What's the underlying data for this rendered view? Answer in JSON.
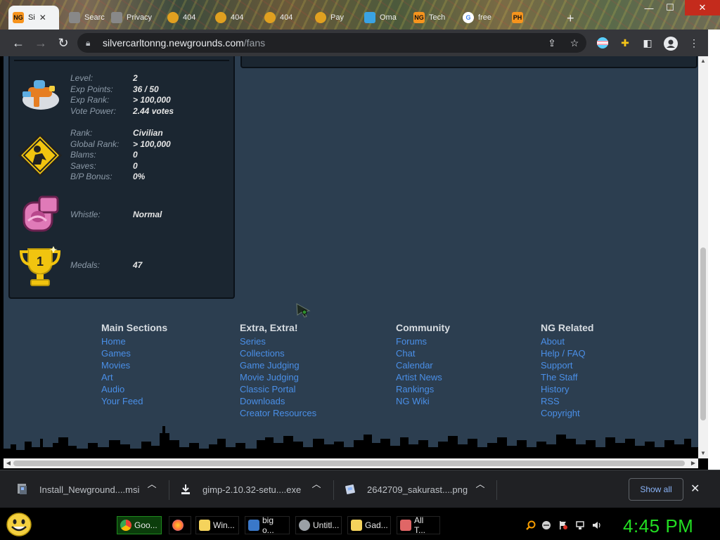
{
  "browser": {
    "tabs": [
      {
        "label": "Si",
        "favicon_color": "#f7941d",
        "favicon_text": "NG",
        "active": true
      },
      {
        "label": "Searc",
        "favicon_color": "#888888",
        "favicon_text": ""
      },
      {
        "label": "Privacy",
        "favicon_color": "#888888",
        "favicon_text": ""
      },
      {
        "label": "404",
        "favicon_color": "#e0a020",
        "favicon_text": ""
      },
      {
        "label": "404",
        "favicon_color": "#e0a020",
        "favicon_text": ""
      },
      {
        "label": "404",
        "favicon_color": "#e0a020",
        "favicon_text": ""
      },
      {
        "label": "Pay",
        "favicon_color": "#e0a020",
        "favicon_text": ""
      },
      {
        "label": "Oma",
        "favicon_color": "#3aa3e3",
        "favicon_text": ""
      },
      {
        "label": "Tech",
        "favicon_color": "#f7941d",
        "favicon_text": "NG"
      },
      {
        "label": "free",
        "favicon_color": "#ffffff",
        "favicon_text": "G"
      },
      {
        "label": "",
        "favicon_color": "#f7941d",
        "favicon_text": "PH"
      }
    ],
    "new_tab": "+",
    "window_controls": {
      "minimize": "—",
      "maximize": "☐",
      "close": "✕"
    },
    "url_host": "silvercarltonng.newgrounds.com",
    "url_path": "/fans"
  },
  "profile": {
    "level": {
      "label": "Level:",
      "value": "2"
    },
    "exp_points": {
      "label": "Exp Points:",
      "value": "36 / 50"
    },
    "exp_rank": {
      "label": "Exp Rank:",
      "value": "> 100,000"
    },
    "vote_power": {
      "label": "Vote Power:",
      "value": "2.44 votes"
    },
    "rank": {
      "label": "Rank:",
      "value": "Civilian"
    },
    "global_rank": {
      "label": "Global Rank:",
      "value": "> 100,000"
    },
    "blams": {
      "label": "Blams:",
      "value": "0"
    },
    "saves": {
      "label": "Saves:",
      "value": "0"
    },
    "bp_bonus": {
      "label": "B/P Bonus:",
      "value": "0%"
    },
    "whistle": {
      "label": "Whistle:",
      "value": "Normal"
    },
    "medals": {
      "label": "Medals:",
      "value": "47"
    }
  },
  "footer": {
    "main_sections": {
      "heading": "Main Sections",
      "links": [
        "Home",
        "Games",
        "Movies",
        "Art",
        "Audio",
        "Your Feed"
      ]
    },
    "extra": {
      "heading": "Extra, Extra!",
      "links": [
        "Series",
        "Collections",
        "Game Judging",
        "Movie Judging",
        "Classic Portal",
        "Downloads",
        "Creator Resources"
      ]
    },
    "community": {
      "heading": "Community",
      "links": [
        "Forums",
        "Chat",
        "Calendar",
        "Artist News",
        "Rankings",
        "NG Wiki"
      ]
    },
    "ng_related": {
      "heading": "NG Related",
      "links": [
        "About",
        "Help / FAQ",
        "Support",
        "The Staff",
        "History",
        "RSS",
        "Copyright"
      ]
    }
  },
  "downloads": {
    "items": [
      {
        "name": "Install_Newground....msi"
      },
      {
        "name": "gimp-2.10.32-setu....exe"
      },
      {
        "name": "2642709_sakurast....png"
      }
    ],
    "show_all": "Show all",
    "close": "✕"
  },
  "taskbar": {
    "buttons": [
      {
        "label": "Goo...",
        "active": true,
        "icon_color": "#4285f4"
      },
      {
        "label": "",
        "active": false,
        "icon_color": "#ff7139"
      },
      {
        "label": "Win...",
        "active": false,
        "icon_color": "#f5d35c"
      },
      {
        "label": "big o...",
        "active": false,
        "icon_color": "#3a78c9"
      },
      {
        "label": "Untitl...",
        "active": false,
        "icon_color": "#9aa0a6"
      },
      {
        "label": "Gad...",
        "active": false,
        "icon_color": "#f5d35c"
      },
      {
        "label": "All T...",
        "active": false,
        "icon_color": "#e06666"
      }
    ],
    "clock": "4:45 PM"
  }
}
